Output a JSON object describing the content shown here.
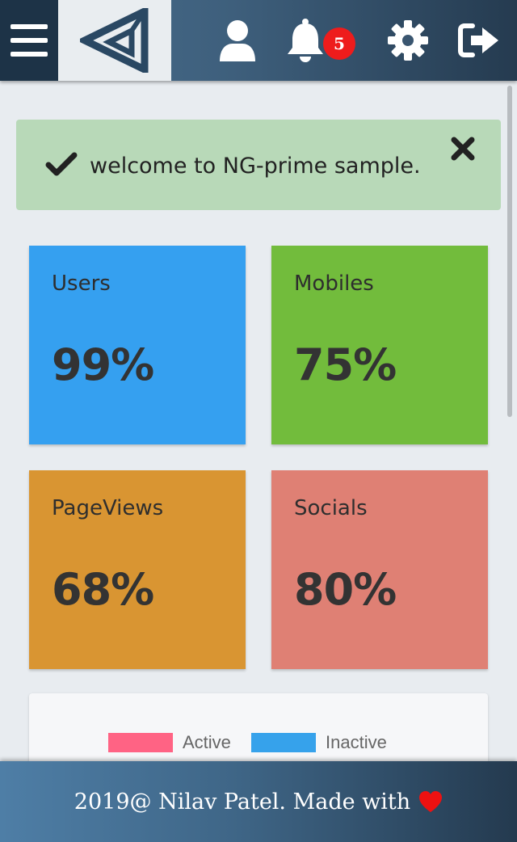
{
  "header": {
    "notification_count": "5",
    "icons": [
      "menu-icon",
      "logo-icon",
      "user-icon",
      "bell-icon",
      "gear-icon",
      "sign-out-icon"
    ]
  },
  "alert": {
    "message": "welcome to NG-prime sample.",
    "color": "#b8d9b8"
  },
  "cards": [
    {
      "title": "Users",
      "value": "99%",
      "color": "#35a0f0"
    },
    {
      "title": "Mobiles",
      "value": "75%",
      "color": "#72bc3c"
    },
    {
      "title": "PageViews",
      "value": "68%",
      "color": "#d99532"
    },
    {
      "title": "Socials",
      "value": "80%",
      "color": "#df8074"
    }
  ],
  "chart_legend": [
    {
      "label": "Active",
      "color": "#ff6384"
    },
    {
      "label": "Inactive",
      "color": "#36a2eb"
    }
  ],
  "footer": {
    "text": "2019@ Nilav Patel. Made with",
    "heart_color": "#ee1111"
  }
}
